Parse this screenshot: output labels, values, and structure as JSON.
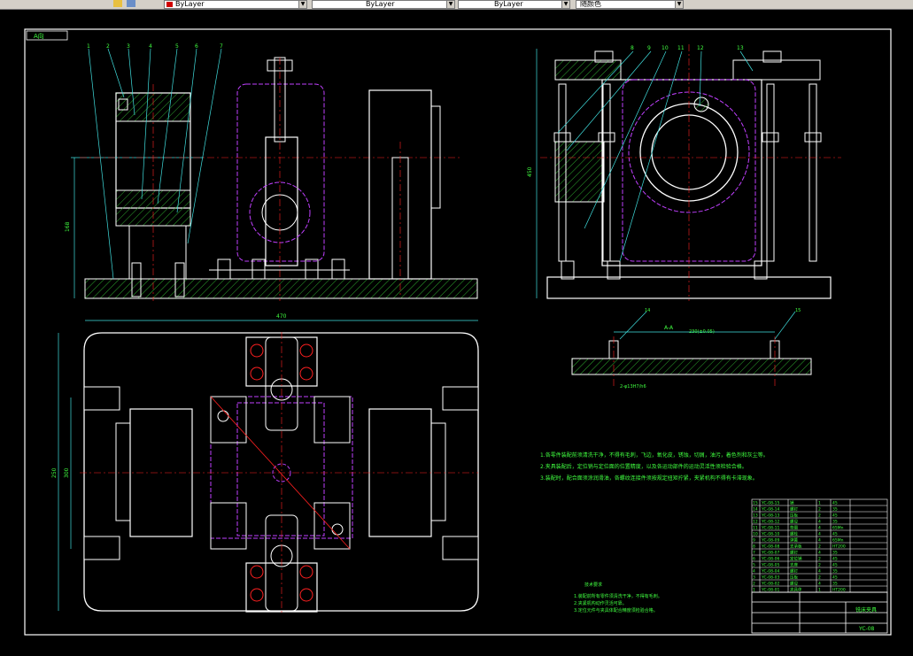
{
  "toolbar": {
    "linetype_1": "ByLayer",
    "linetype_2": "ByLayer",
    "linetype_3": "ByLayer",
    "plot_style": "随颜色"
  },
  "drawing": {
    "view_label": "A向",
    "section_label": "A-A",
    "part_labels_left": [
      "1",
      "2",
      "3",
      "4",
      "5",
      "6",
      "7"
    ],
    "part_labels_right": [
      "8",
      "9",
      "10",
      "11",
      "12",
      "13"
    ],
    "part_labels_small": [
      "14",
      "15"
    ],
    "dim_side_height": "168",
    "dim_front_height": "450",
    "dim_plan_width": "470",
    "dim_plan_height": "250",
    "dim_plan_height_inner": "300",
    "dim_small_width": "230(±0.05)",
    "dim_small_hole": "2-φ13H7/h6",
    "tech_requirements_title": "技术要求",
    "tech_notes": [
      "1.各零件装配前须清洗干净，不得有毛刺，飞边，氧化皮，锈蚀，切屑，油污，着色剂和灰尘等。",
      "2.夹具装配后，定位销与定位面的位置精度，以及各运动部件的运动灵活性须检验合格。",
      "3.装配时，配合面须涂润滑油，各螺纹连接件须按规定扭矩拧紧，夹紧机构不得有卡滞现象。"
    ],
    "tech_requirements_lines": [
      "1.装配前所有零件须清洗干净，不得有毛刺。",
      "2.夹紧机构动作灵活可靠。",
      "3.定位元件与夹具体配合精度须检验合格。"
    ]
  },
  "bom": {
    "rows": [
      [
        "15",
        "YC-08-15",
        "销",
        "1",
        "45"
      ],
      [
        "14",
        "YC-08-14",
        "螺钉",
        "2",
        "35"
      ],
      [
        "13",
        "YC-08-13",
        "压板",
        "2",
        "45"
      ],
      [
        "12",
        "YC-08-12",
        "螺母",
        "4",
        "35"
      ],
      [
        "11",
        "YC-08-11",
        "垫圈",
        "4",
        "65Mn"
      ],
      [
        "10",
        "YC-08-10",
        "螺栓",
        "4",
        "45"
      ],
      [
        "9",
        "YC-08-09",
        "弹簧",
        "4",
        "65Mn"
      ],
      [
        "8",
        "YC-08-08",
        "支承板",
        "2",
        "HT200"
      ],
      [
        "7",
        "YC-08-07",
        "螺钉",
        "4",
        "35"
      ],
      [
        "6",
        "YC-08-06",
        "定位销",
        "2",
        "45"
      ],
      [
        "5",
        "YC-08-05",
        "支座",
        "2",
        "45"
      ],
      [
        "4",
        "YC-08-04",
        "螺钉",
        "4",
        "35"
      ],
      [
        "3",
        "YC-08-03",
        "压板",
        "2",
        "45"
      ],
      [
        "2",
        "YC-08-02",
        "螺母",
        "4",
        "35"
      ],
      [
        "1",
        "YC-08-01",
        "夹具体",
        "1",
        "HT200"
      ]
    ],
    "title_name": "铣床夹具",
    "drawing_number": "YC-08"
  },
  "colors": {
    "background": "#000000",
    "line_white": "#ffffff",
    "center_red": "#ff2020",
    "hatch_green": "#2ea82e",
    "hidden_magenta": "#c040ff",
    "dim_cyan": "#40e0e0",
    "text_green": "#40ff40",
    "table_green": "#40ff40"
  }
}
